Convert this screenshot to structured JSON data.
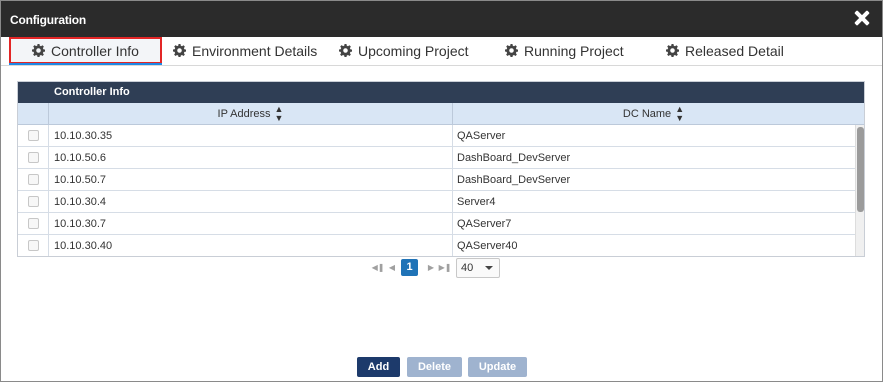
{
  "dialog": {
    "title": "Configuration"
  },
  "tabs": [
    {
      "label": "Controller Info",
      "icon": "gear-icon",
      "active": true
    },
    {
      "label": "Environment Details",
      "icon": "gear-icon"
    },
    {
      "label": "Upcoming Project",
      "icon": "gear-icon"
    },
    {
      "label": "Running Project",
      "icon": "gear-icon"
    },
    {
      "label": "Released Detail",
      "icon": "gear-icon"
    }
  ],
  "grid": {
    "title": "Controller Info",
    "columns": [
      {
        "label": "IP Address",
        "sort_icon": "sort-icon"
      },
      {
        "label": "DC Name",
        "sort_icon": "sort-icon"
      }
    ],
    "rows": [
      {
        "ip": "10.10.30.35",
        "dc": "QAServer"
      },
      {
        "ip": "10.10.50.6",
        "dc": "DashBoard_DevServer"
      },
      {
        "ip": "10.10.50.7",
        "dc": "DashBoard_DevServer"
      },
      {
        "ip": "10.10.30.4",
        "dc": "Server4"
      },
      {
        "ip": "10.10.30.7",
        "dc": "QAServer7"
      },
      {
        "ip": "10.10.30.40",
        "dc": "QAServer40"
      }
    ]
  },
  "pager": {
    "current_page": "1",
    "page_size": "40"
  },
  "buttons": {
    "add": "Add",
    "delete": "Delete",
    "update": "Update"
  },
  "colors": {
    "header_dark": "#2b2b2b",
    "grid_header": "#2f3e55",
    "accent": "#1f73b7",
    "active_tab_border": "#e32626"
  }
}
